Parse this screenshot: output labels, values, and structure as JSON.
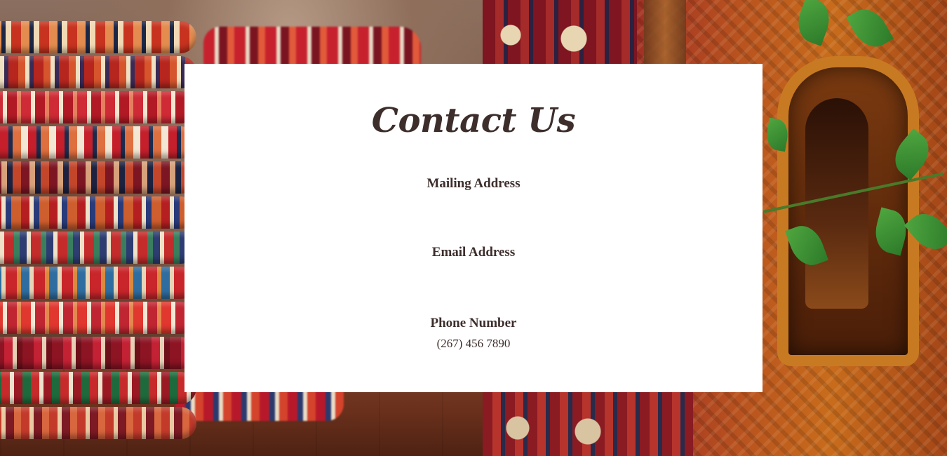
{
  "contact": {
    "title": "Contact Us",
    "mailing_label": "Mailing Address",
    "email_label": "Email Address",
    "phone_label": "Phone Number",
    "phone_value": "(267) 456 7890"
  },
  "colors": {
    "text": "#3d2e2c",
    "card_background": "#ffffff"
  }
}
